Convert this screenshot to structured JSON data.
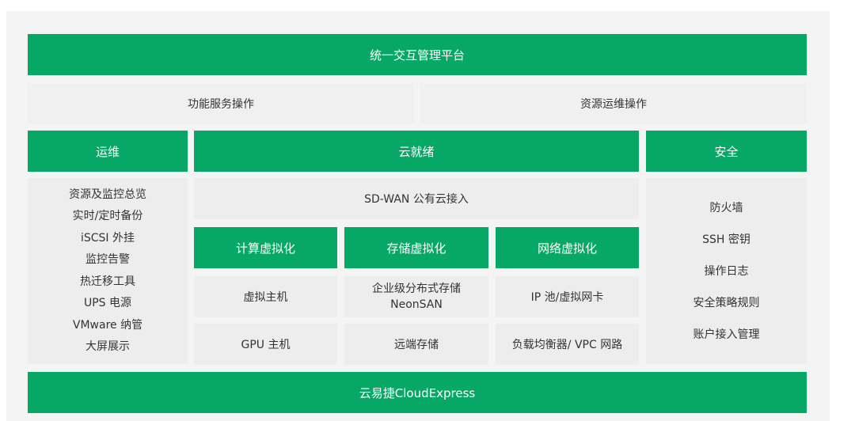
{
  "platform": {
    "title": "统一交互管理平台"
  },
  "operations": {
    "function_service": "功能服务操作",
    "resource_ops": "资源运维操作"
  },
  "ops": {
    "title": "运维",
    "items": [
      "资源及监控总览",
      "实时/定时备份",
      "iSCSI 外挂",
      "监控告警",
      "热迁移工具",
      "UPS 电源",
      "VMware 纳管",
      "大屏展示"
    ]
  },
  "cloud_ready": {
    "title": "云就绪",
    "sdwan": "SD-WAN 公有云接入",
    "compute": {
      "title": "计算虚拟化",
      "items": [
        "虚拟主机",
        "GPU 主机"
      ]
    },
    "storage": {
      "title": "存储虚拟化",
      "items": [
        "企业级分布式存储",
        "NeonSAN",
        "远端存储"
      ]
    },
    "network": {
      "title": "网络虚拟化",
      "items": [
        "IP 池/虚拟网卡",
        "负载均衡器/ VPC 网路"
      ]
    }
  },
  "security": {
    "title": "安全",
    "items": [
      "防火墙",
      "SSH 密钥",
      "操作日志",
      "安全策略规则",
      "账户接入管理"
    ]
  },
  "footer": {
    "title": "云易捷CloudExpress"
  },
  "colors": {
    "accent": "#07a866",
    "panel": "#ededed",
    "background": "#f4f4f4"
  }
}
